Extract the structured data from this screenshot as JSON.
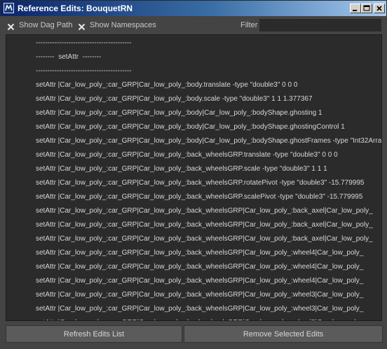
{
  "window": {
    "title": "Reference Edits: BouquetRN",
    "controls": [
      "minimize-icon",
      "maximize-icon",
      "close-icon"
    ]
  },
  "toolbar": {
    "show_dag_path": {
      "label": "Show Dag Path",
      "checked": true
    },
    "show_namespaces": {
      "label": "Show Namespaces",
      "checked": true
    },
    "filter_label": "Filter",
    "filter_value": ""
  },
  "edits": [
    "-----------------------------------------",
    "--------  setAttr  --------",
    "-----------------------------------------",
    "setAttr |Car_low_poly_:car_GRP|Car_low_poly_:body.translate -type \"double3\" 0 0 0",
    "setAttr |Car_low_poly_:car_GRP|Car_low_poly_:body.scale -type \"double3\" 1 1 1.377367",
    "setAttr |Car_low_poly_:car_GRP|Car_low_poly_:body|Car_low_poly_:bodyShape.ghosting 1",
    "setAttr |Car_low_poly_:car_GRP|Car_low_poly_:body|Car_low_poly_:bodyShape.ghostingControl 1",
    "setAttr |Car_low_poly_:car_GRP|Car_low_poly_:body|Car_low_poly_:bodyShape.ghostFrames -type \"Int32Array\"",
    "setAttr |Car_low_poly_:car_GRP|Car_low_poly_:back_wheelsGRP.translate -type \"double3\" 0 0 0",
    "setAttr |Car_low_poly_:car_GRP|Car_low_poly_:back_wheelsGRP.scale -type \"double3\" 1 1 1",
    "setAttr |Car_low_poly_:car_GRP|Car_low_poly_:back_wheelsGRP.rotatePivot -type \"double3\" -15.779995",
    "setAttr |Car_low_poly_:car_GRP|Car_low_poly_:back_wheelsGRP.scalePivot -type \"double3\" -15.779995",
    "setAttr |Car_low_poly_:car_GRP|Car_low_poly_:back_wheelsGRP|Car_low_poly_:back_axel|Car_low_poly_",
    "setAttr |Car_low_poly_:car_GRP|Car_low_poly_:back_wheelsGRP|Car_low_poly_:back_axel|Car_low_poly_",
    "setAttr |Car_low_poly_:car_GRP|Car_low_poly_:back_wheelsGRP|Car_low_poly_:back_axel|Car_low_poly_",
    "setAttr |Car_low_poly_:car_GRP|Car_low_poly_:back_wheelsGRP|Car_low_poly_:wheel4|Car_low_poly_",
    "setAttr |Car_low_poly_:car_GRP|Car_low_poly_:back_wheelsGRP|Car_low_poly_:wheel4|Car_low_poly_",
    "setAttr |Car_low_poly_:car_GRP|Car_low_poly_:back_wheelsGRP|Car_low_poly_:wheel4|Car_low_poly_",
    "setAttr |Car_low_poly_:car_GRP|Car_low_poly_:back_wheelsGRP|Car_low_poly_:wheel3|Car_low_poly_",
    "setAttr |Car_low_poly_:car_GRP|Car_low_poly_:back_wheelsGRP|Car_low_poly_:wheel3|Car_low_poly_",
    "setAttr |Car_low_poly_:car_GRP|Car_low_poly_:back_wheelsGRP|Car_low_poly_:wheel3|Car_low_poly_"
  ],
  "buttons": {
    "refresh": "Refresh Edits List",
    "remove": "Remove Selected Edits"
  }
}
